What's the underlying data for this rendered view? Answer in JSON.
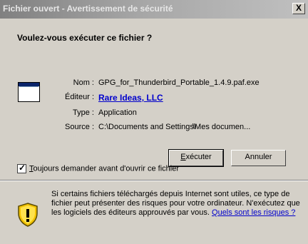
{
  "window": {
    "title": "Fichier ouvert - Avertissement de sécurité",
    "close_glyph": "X"
  },
  "dialog": {
    "heading": "Voulez-vous exécuter ce fichier ?",
    "fields": {
      "name_label": "Nom :",
      "name_value": "GPG_for_Thunderbird_Portable_1.4.9.paf.exe",
      "publisher_label": "Éditeur :",
      "publisher_value": "Rare Ideas, LLC",
      "type_label": "Type :",
      "type_value": "Application",
      "source_label": "Source :",
      "source_value": "C:\\Documents and Settings\\",
      "source_value_end": "\\Mes documen..."
    },
    "buttons": {
      "run_prefix": "",
      "run_accel": "E",
      "run_rest": "xécuter",
      "cancel": "Annuler"
    },
    "checkbox": {
      "accel": "T",
      "label_rest": "oujours demander avant d'ouvrir ce fichier",
      "checked": true
    },
    "warning": {
      "text": "Si certains fichiers téléchargés depuis Internet sont utiles, ce type de fichier peut présenter des risques pour votre ordinateur. N'exécutez que les logiciels des éditeurs approuvés par vous. ",
      "link": "Quels sont les risques ?"
    }
  },
  "icons": {
    "application": "application-window-icon",
    "shield": "security-shield-icon"
  },
  "colors": {
    "title_gradient_start": "#808080",
    "title_gradient_end": "#c0c0c0",
    "dialog_bg": "#d4d0c8",
    "link": "#0000cc"
  }
}
